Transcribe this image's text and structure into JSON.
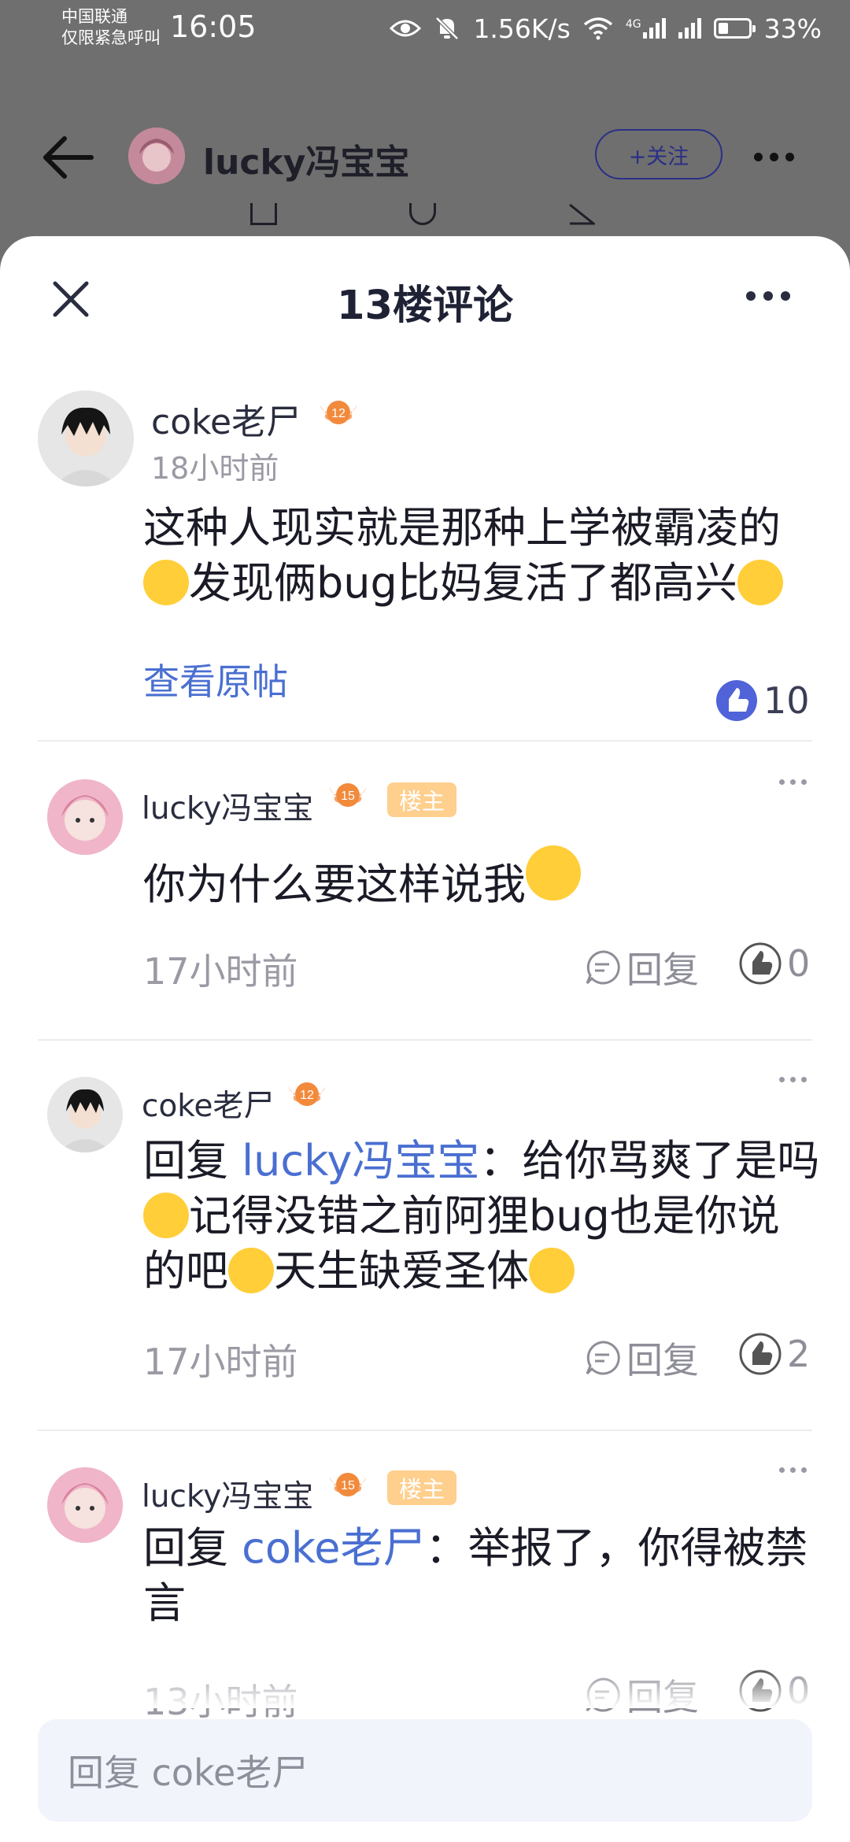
{
  "status_bar": {
    "carrier_line1": "中国联通",
    "carrier_line2": "仅限紧急呼叫",
    "time": "16:05",
    "net_speed": "1.56K/s",
    "signal_label": "4G",
    "battery": "33%",
    "icons": [
      "eye-icon",
      "bell-off-icon",
      "wifi-icon",
      "signal-icon",
      "no-sim-icon",
      "battery-icon"
    ]
  },
  "page_header": {
    "username": "lucky冯宝宝",
    "follow_label": "+关注"
  },
  "sheet": {
    "title": "13楼评论"
  },
  "main_comment": {
    "author": "coke老尸",
    "level": "12",
    "time": "18小时前",
    "text_part1": "这种人现实就是那种上学被霸凌的",
    "text_part2": "发现俩bug比妈复活了都高兴",
    "view_original": "查看原帖",
    "likes": "10"
  },
  "replies": [
    {
      "author": "lucky冯宝宝",
      "level": "15",
      "op_badge": "楼主",
      "text": "你为什么要这样说我",
      "time": "17小时前",
      "reply_label": "回复",
      "likes": "0"
    },
    {
      "author": "coke老尸",
      "level": "12",
      "reply_prefix": "回复",
      "reply_to": "lucky冯宝宝",
      "text_part1": "：给你骂爽了是吗",
      "text_part2": "记得没错之前阿狸bug也是你说",
      "text_part3": "的吧",
      "text_part4": "天生缺爱圣体",
      "time": "17小时前",
      "reply_label": "回复",
      "likes": "2"
    },
    {
      "author": "lucky冯宝宝",
      "level": "15",
      "op_badge": "楼主",
      "reply_prefix": "回复",
      "reply_to": "coke老尸",
      "text_part1": "：举报了，你得被禁",
      "text_part2": "言",
      "time": "13小时前",
      "reply_label": "回复",
      "likes": "0"
    }
  ],
  "input": {
    "placeholder": "回复 coke老尸"
  },
  "colors": {
    "accent_blue": "#4a6fd1",
    "op_badge": "#ffcf8e",
    "level_badge": "#f28a3c",
    "overlay": "#6f6f6f"
  }
}
